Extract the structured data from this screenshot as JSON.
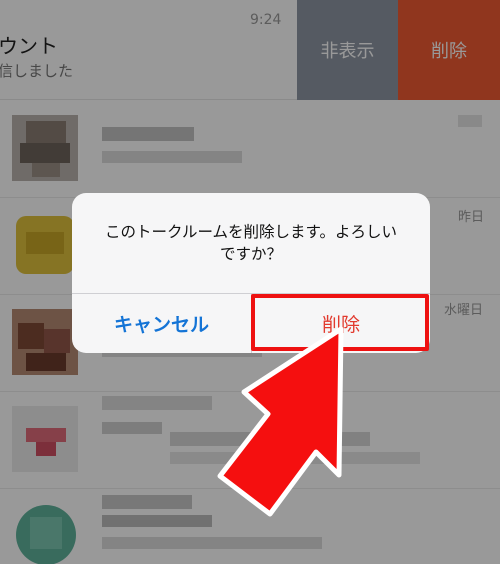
{
  "top_row": {
    "name": "ウント",
    "preview": "信しました",
    "time": "9:24",
    "hide_action": "非表示",
    "delete_action": "削除"
  },
  "rows": [
    {
      "time": ""
    },
    {
      "time": "昨日"
    },
    {
      "time": "水曜日"
    },
    {
      "time": ""
    },
    {
      "time": ""
    }
  ],
  "dialog": {
    "message_line1": "このトークルームを削除します。よろしい",
    "message_line2": "ですか？",
    "cancel_label": "キャンセル",
    "delete_label": "削除"
  },
  "colors": {
    "hide_bg": "#8e96a4",
    "delete_bg": "#f05a33",
    "cancel_text": "#1474d6",
    "delete_text": "#e23a2e",
    "annotation": "#ee1111"
  }
}
